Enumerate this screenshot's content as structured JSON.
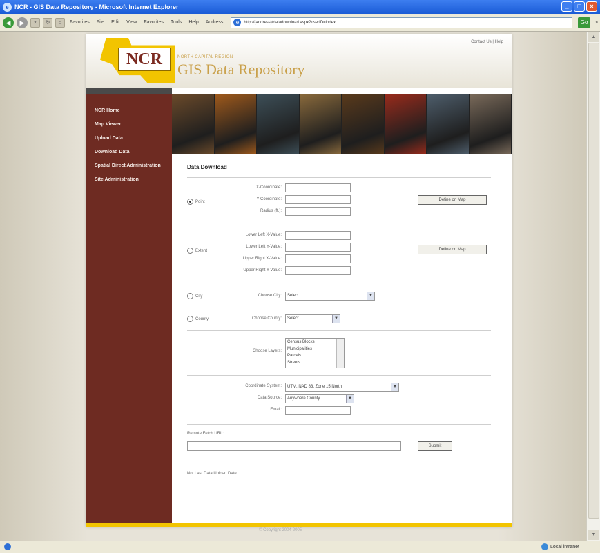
{
  "window": {
    "title": "NCR - GIS Data Repository - Microsoft Internet Explorer",
    "controls": [
      "_",
      "□",
      "×"
    ]
  },
  "toolbar": {
    "back": "◀",
    "forward": "▶",
    "items": [
      "Favorites",
      "File",
      "Edit",
      "View",
      "Favorites",
      "Tools",
      "Help"
    ],
    "address_label": "Address",
    "address": "http://(address)/datadownload.aspx?userID=index",
    "go_label": "Go",
    "links_label": "»"
  },
  "statusbar": {
    "zone": "Local intranet"
  },
  "header": {
    "contact": "Contact Us | Help",
    "logo_text": "NCR",
    "subtitle": "NORTH CAPITAL REGION",
    "app_title": "GIS Data Repository"
  },
  "sidebar": {
    "items": [
      {
        "label": "NCR Home"
      },
      {
        "label": "Map Viewer"
      },
      {
        "label": "Upload Data"
      },
      {
        "label": "Download Data"
      },
      {
        "label": "Spatial Direct Administration"
      },
      {
        "label": "Site Administration"
      }
    ]
  },
  "colors": {
    "sidebar": "#6e2b22",
    "accent_gold": "#c9a04a",
    "logo_yellow": "#f2c400",
    "banner_tiles": [
      "#6b4a2a",
      "#a05a1c",
      "#3d4f58",
      "#8a6a3c",
      "#5a3a1c",
      "#9a2b1c",
      "#4e5e6c",
      "#7a6a5a"
    ]
  },
  "form": {
    "heading": "Data Download",
    "point": {
      "radio_label": "Point",
      "selected": true,
      "fields": [
        {
          "label": "X-Coordinate:",
          "value": ""
        },
        {
          "label": "Y-Coordinate:",
          "value": ""
        },
        {
          "label": "Radius (ft.):",
          "value": ""
        }
      ],
      "map_button": "Define on Map"
    },
    "extent": {
      "radio_label": "Extent",
      "selected": false,
      "fields": [
        {
          "label": "Lower Left X-Value:",
          "value": ""
        },
        {
          "label": "Lower Left Y-Value:",
          "value": ""
        },
        {
          "label": "Upper Right X-Value:",
          "value": ""
        },
        {
          "label": "Upper Right Y-Value:",
          "value": ""
        }
      ],
      "map_button": "Define on Map"
    },
    "city": {
      "radio_label": "City",
      "label": "Choose City:",
      "value": "Select..."
    },
    "county": {
      "radio_label": "County",
      "label": "Choose County:",
      "value": "Select..."
    },
    "layers": {
      "label": "Choose Layers:",
      "options": [
        "Census Blocks",
        "Municipalities",
        "Parcels",
        "Streets"
      ]
    },
    "coord_system": {
      "label": "Coordinate System:",
      "value": "UTM, NAD 83, Zone 15 North"
    },
    "data_source": {
      "label": "Data Source:",
      "value": "Anywhere County"
    },
    "email": {
      "label": "Email:",
      "value": ""
    },
    "remote_fetch": {
      "label": "Remote Fetch URL:",
      "value": "",
      "submit": "Submit"
    },
    "bottom_link": "Not Last Data Upload Date"
  },
  "footer": {
    "copyright": "© Copyright 2004-2005"
  }
}
